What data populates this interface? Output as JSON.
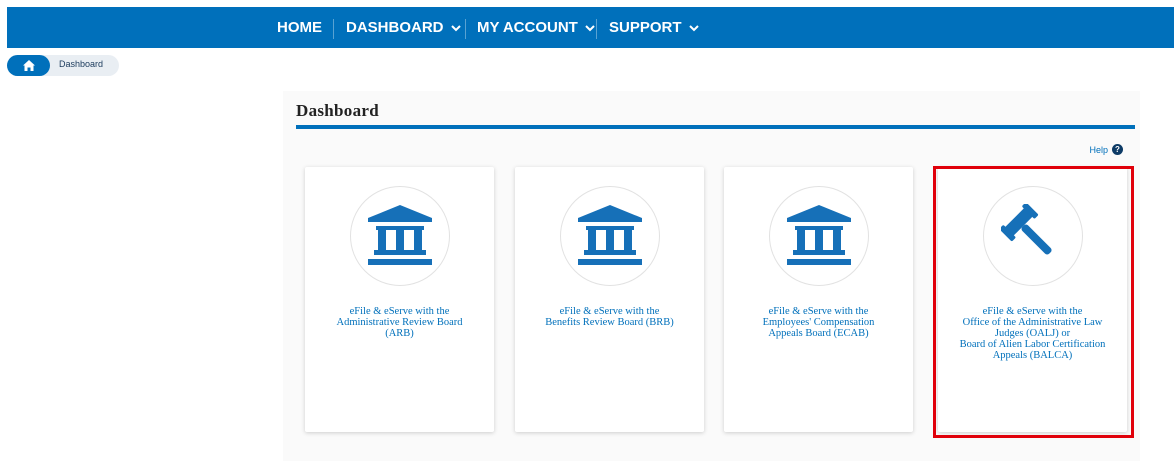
{
  "nav": {
    "home": "HOME",
    "dashboard": "DASHBOARD",
    "my_account": "MY ACCOUNT",
    "support": "SUPPORT",
    "bar_color": "#0070bb"
  },
  "breadcrumb": {
    "home_icon": "home-icon",
    "current": "Dashboard"
  },
  "main": {
    "title": "Dashboard",
    "help_label": "Help",
    "help_icon": "question-circle-icon"
  },
  "cards": [
    {
      "icon": "courthouse-icon",
      "line1": "eFile & eServe with the",
      "line2": "Administrative Review Board",
      "line3": "(ARB)"
    },
    {
      "icon": "courthouse-icon",
      "line1": "eFile & eServe with the",
      "line2": "Benefits Review Board (BRB)"
    },
    {
      "icon": "courthouse-icon",
      "line1": "eFile & eServe with the",
      "line2": "Employees' Compensation",
      "line3": "Appeals Board (ECAB)"
    },
    {
      "icon": "gavel-icon",
      "line1": "eFile & eServe with the",
      "line2": "Office of the Administrative Law",
      "line3": "Judges (OALJ) or",
      "line4": "Board of Alien Labor Certification",
      "line5": "Appeals (BALCA)"
    }
  ],
  "highlight_color": "#e0000a"
}
